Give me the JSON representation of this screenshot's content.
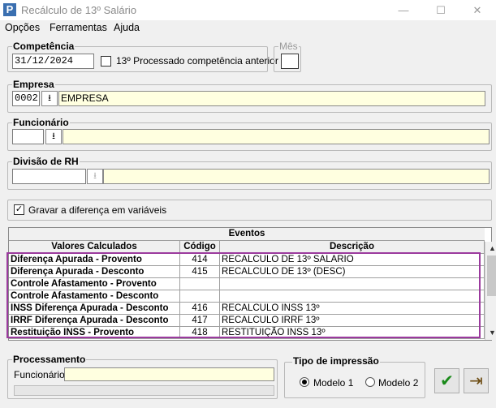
{
  "window": {
    "title": "Recálculo de 13º Salário",
    "app_icon_letter": "P",
    "minimize": "—",
    "maximize": "☐",
    "close": "✕"
  },
  "menu": [
    "Opções",
    "Ferramentas",
    "Ajuda"
  ],
  "competencia": {
    "label": "Competência",
    "value": "31/12/2024",
    "processado_label": "13º Processado competência anterior",
    "processado_checked": false
  },
  "mes": {
    "label": "Mês",
    "value": ""
  },
  "empresa": {
    "label": "Empresa",
    "code": "0002",
    "name": "EMPRESA"
  },
  "funcionario": {
    "label": "Funcionário",
    "code": "",
    "name": ""
  },
  "divisao": {
    "label": "Divisão de RH",
    "code": "",
    "name": ""
  },
  "gravar": {
    "label": "Gravar a diferença em variáveis",
    "checked": true,
    "mark": "✓"
  },
  "eventos": {
    "title": "Eventos",
    "columns": [
      "Valores Calculados",
      "Código",
      "Descrição"
    ],
    "rows": [
      {
        "valor": "Diferença Apurada - Provento",
        "codigo": "414",
        "descricao": "RECALCULO DE 13º SALARIO"
      },
      {
        "valor": "Diferença Apurada - Desconto",
        "codigo": "415",
        "descricao": "RECALCULO DE 13º (DESC)"
      },
      {
        "valor": "Controle Afastamento - Provento",
        "codigo": "",
        "descricao": ""
      },
      {
        "valor": "Controle Afastamento - Desconto",
        "codigo": "",
        "descricao": ""
      },
      {
        "valor": "INSS Diferença Apurada - Desconto",
        "codigo": "416",
        "descricao": "RECALCULO  INSS 13º"
      },
      {
        "valor": "IRRF Diferença Apurada - Desconto",
        "codigo": "417",
        "descricao": "RECALCULO IRRF 13º"
      },
      {
        "valor": "Restituição INSS - Provento",
        "codigo": "418",
        "descricao": "RESTITUIÇÃO INSS 13º"
      }
    ],
    "highlight_color": "#9b3a9e"
  },
  "processamento": {
    "label": "Processamento",
    "funcionario_label": "Funcionário:",
    "funcionario_value": ""
  },
  "impressao": {
    "label": "Tipo de impressão",
    "options": [
      "Modelo 1",
      "Modelo 2"
    ],
    "selected": "Modelo 1"
  },
  "buttons": {
    "confirm_glyph": "✔",
    "exit_glyph": "⇥"
  },
  "colors": {
    "field_yellow": "#ffffe0",
    "confirm_green": "#1a8a1a"
  }
}
